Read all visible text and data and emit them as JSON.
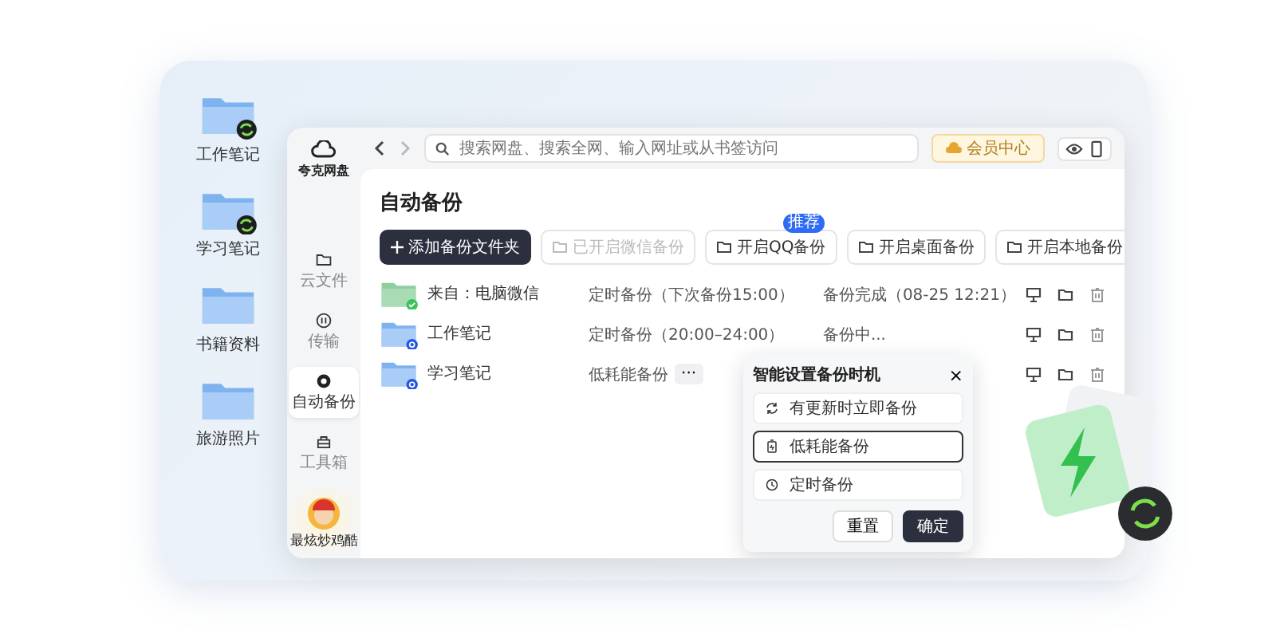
{
  "desktop": {
    "icons": [
      {
        "label": "工作笔记",
        "synced": true
      },
      {
        "label": "学习笔记",
        "synced": true
      },
      {
        "label": "书籍资料",
        "synced": false
      },
      {
        "label": "旅游照片",
        "synced": false
      }
    ]
  },
  "sidebar": {
    "logo": "夸克网盘",
    "items": [
      {
        "label": "云文件",
        "kind": "folder",
        "selected": false
      },
      {
        "label": "传输",
        "kind": "transfer",
        "selected": false
      },
      {
        "label": "自动备份",
        "kind": "backup",
        "selected": true
      },
      {
        "label": "工具箱",
        "kind": "toolbox",
        "selected": false
      }
    ],
    "user": "最炫炒鸡酷"
  },
  "toolbar": {
    "search": {
      "placeholder": "搜索网盘、搜索全网、输入网址或从书签访问"
    },
    "member_button": "会员中心"
  },
  "page": {
    "title": "自动备份",
    "actions": [
      {
        "label": "添加备份文件夹",
        "kind": "primary",
        "disabled": false
      },
      {
        "label": "已开启微信备份",
        "kind": "normal",
        "disabled": true
      },
      {
        "label": "开启QQ备份",
        "kind": "normal",
        "disabled": false,
        "badge": "推荐"
      },
      {
        "label": "开启桌面备份",
        "kind": "normal",
        "disabled": false
      },
      {
        "label": "开启本地备份",
        "kind": "normal",
        "disabled": false
      }
    ],
    "rows": [
      {
        "kind": "wechat",
        "name": "来自：电脑微信",
        "schedule": "定时备份（下次备份15:00）",
        "status": "备份完成（08-25 12:21）"
      },
      {
        "kind": "folder",
        "name": "工作笔记",
        "schedule": "定时备份（20:00–24:00）",
        "status": "备份中..."
      },
      {
        "kind": "folder",
        "name": "学习笔记",
        "schedule": "低耗能备份",
        "more": "···"
      }
    ]
  },
  "popup": {
    "title": "智能设置备份时机",
    "close": "×",
    "options": [
      {
        "label": "有更新时立即备份",
        "kind": "refresh",
        "selected": false
      },
      {
        "label": "低耗能备份",
        "kind": "battery",
        "selected": true
      },
      {
        "label": "定时备份",
        "kind": "clock",
        "selected": false
      }
    ],
    "buttons": [
      {
        "label": "重置",
        "kind": "secondary"
      },
      {
        "label": "确定",
        "kind": "primary"
      }
    ]
  }
}
